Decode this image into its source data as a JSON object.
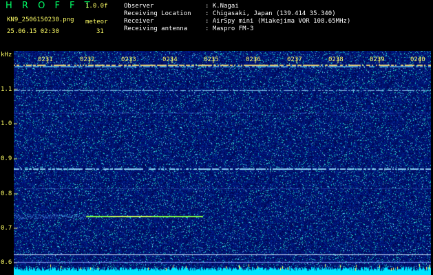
{
  "header": {
    "app_name": "H R O F F T",
    "version": "1.0.0f",
    "filename": "KN9_2506150230.png",
    "meteor_label": "meteor",
    "meteor_count": "31",
    "datetime": "25.06.15 02:30"
  },
  "info": {
    "observer_label": "Observer",
    "observer": ": K.Nagai",
    "location_label": "Receiving Location",
    "location": ": Chigasaki, Japan (139.414 35.340)",
    "receiver_label": "Receiver",
    "receiver": ": AirSpy mini (Miakejima VOR 108.65MHz)",
    "antenna_label": "Receiving antenna",
    "antenna": ": Maspro FM-3"
  },
  "axis": {
    "y_unit": "kHz",
    "y_ticks": [
      "1.1",
      "1.0",
      "0.9",
      "0.8",
      "0.7",
      "0.6"
    ],
    "x_ticks": [
      "0231",
      "0232",
      "0233",
      "0234",
      "0235",
      "0236",
      "0237",
      "0238",
      "0239",
      "0240"
    ]
  },
  "colors": {
    "background": "#0a0a6e",
    "label": "#ffff66",
    "accent": "#00ff66"
  }
}
